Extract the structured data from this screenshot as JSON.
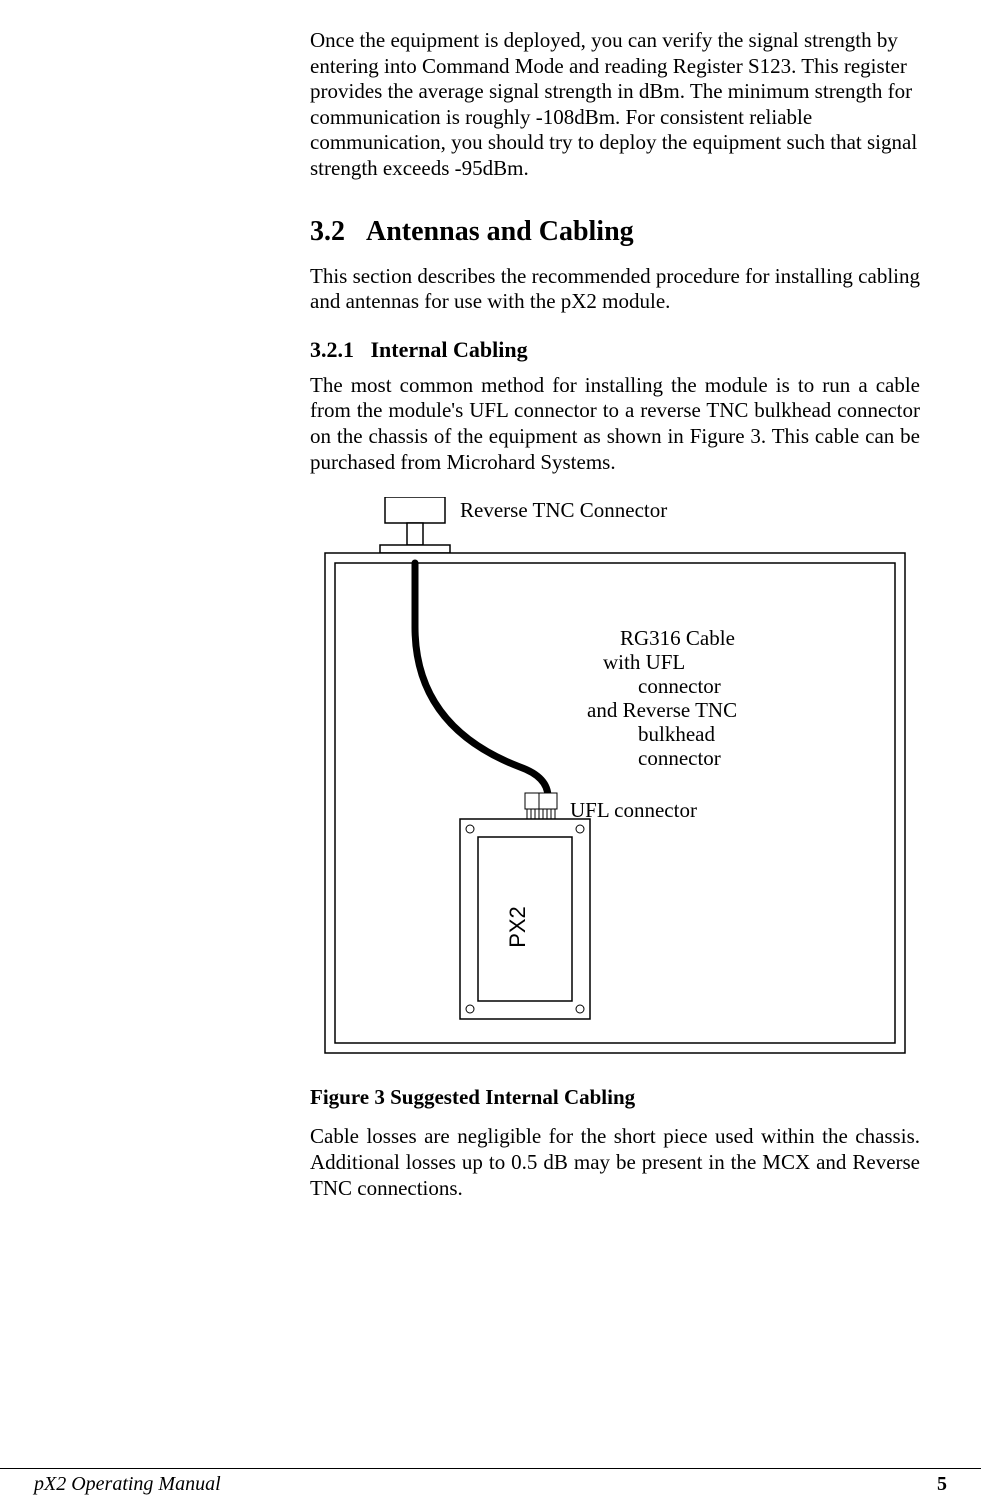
{
  "intro_para": "Once the equipment is deployed, you can verify the signal strength by entering into Command Mode and reading Register S123.  This register provides the average signal strength in dBm.  The minimum strength for communication is roughly -108dBm.  For consistent reliable communication, you should try to deploy the equipment such that signal strength exceeds -95dBm.",
  "section_number": "3.2",
  "section_title": "Antennas and Cabling",
  "section_para": "This section describes the recommended procedure for installing cabling and antennas for use with the pX2 module.",
  "subsection_number": "3.2.1",
  "subsection_title": "Internal Cabling",
  "subsection_para": "The most common method for installing the module is to run a cable from the module's UFL connector to a reverse TNC bulkhead connector on the chassis of the equipment as shown in Figure 3.  This cable can be purchased from Microhard Systems.",
  "figure": {
    "top_label": "Reverse TNC Connector",
    "cable_l1": "RG316 Cable",
    "cable_l2": "with UFL",
    "cable_l3": "connector",
    "cable_l4": "and Reverse TNC",
    "cable_l5": "bulkhead",
    "cable_l6": "connector",
    "ufl_label": "UFL connector",
    "module_label": "PX2"
  },
  "figure_caption": "Figure 3 Suggested Internal Cabling",
  "closing_para": "Cable losses are negligible for the short piece used within the chassis. Additional losses up to 0.5 dB may be present in the MCX and Reverse TNC connections.",
  "footer_left": "pX2 Operating Manual",
  "footer_right": "5"
}
